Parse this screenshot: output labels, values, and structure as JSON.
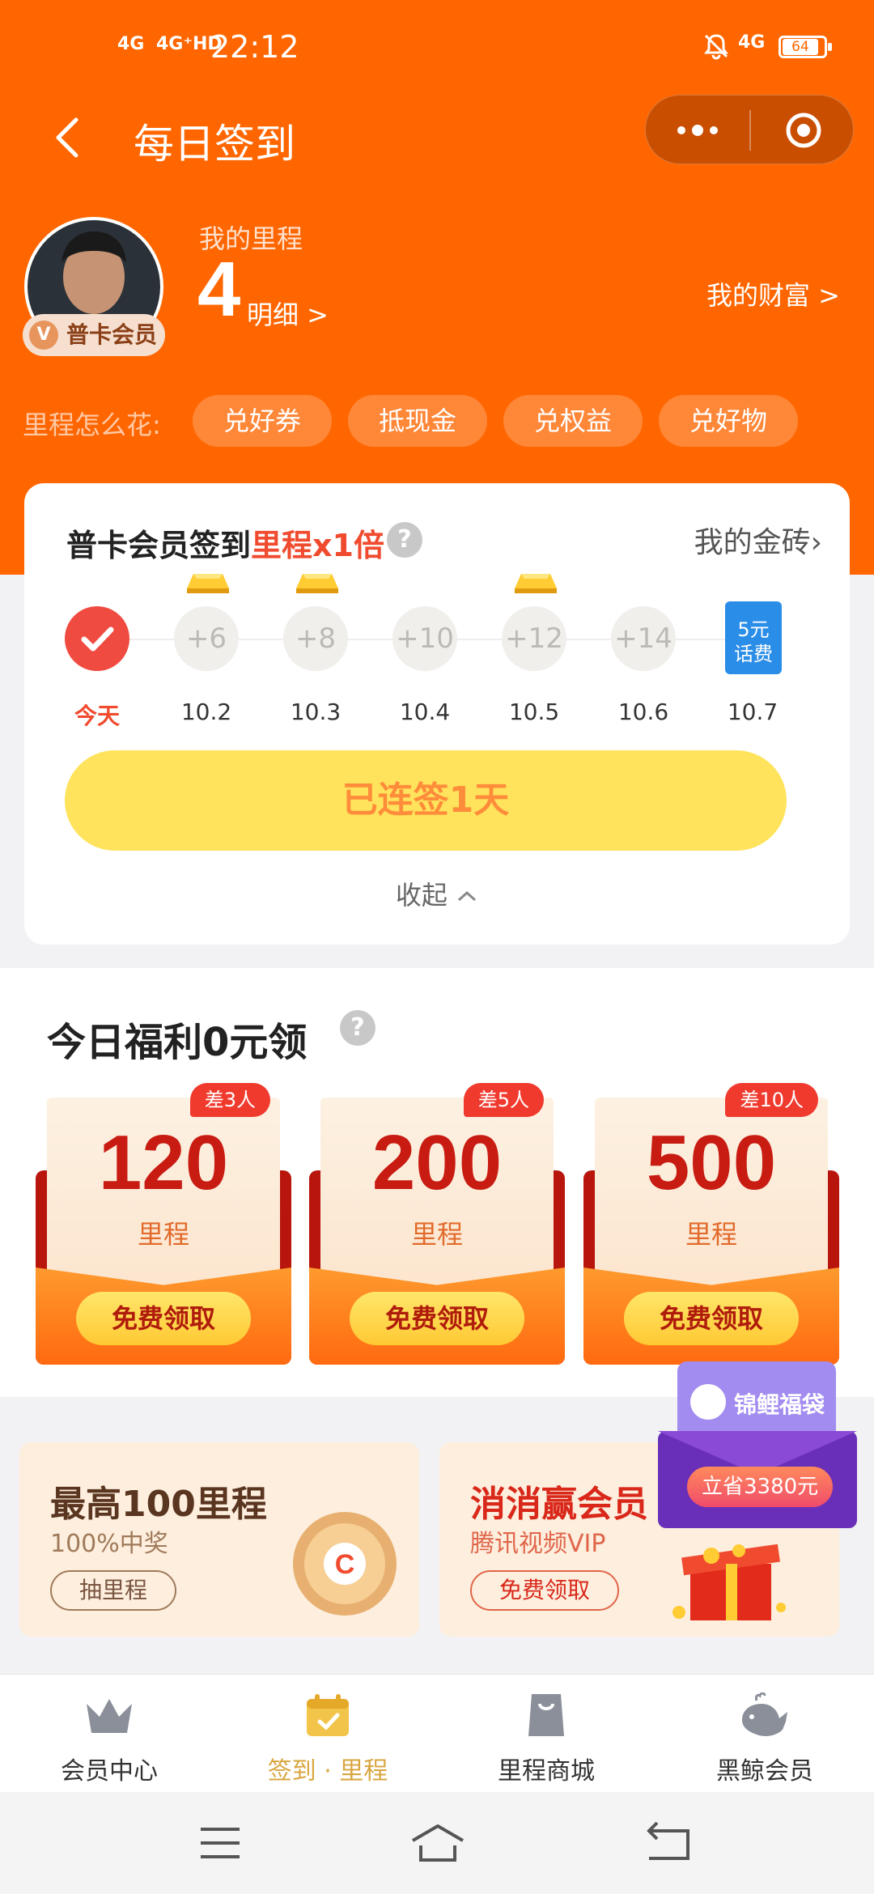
{
  "status_bar": {
    "network_left": "4G",
    "network_left2": "4G⁺HD",
    "time": "22:12",
    "network_right": "4G",
    "battery": "64"
  },
  "nav": {
    "title": "每日签到"
  },
  "profile": {
    "member_level": "普卡会员",
    "member_v": "V",
    "mileage_label": "我的里程",
    "mileage_value": "4",
    "detail_link": "明细 >",
    "wealth_link": "我的财富 >",
    "spend_label": "里程怎么花:",
    "spend_options": [
      "兑好券",
      "抵现金",
      "兑权益",
      "兑好物"
    ]
  },
  "signin": {
    "title_prefix": "普卡会员签到",
    "title_highlight": "里程x1倍",
    "help": "?",
    "bricks_link": "我的金砖›",
    "days": [
      {
        "date": "今天",
        "reward": "",
        "today": true,
        "gold": false
      },
      {
        "date": "10.2",
        "reward": "+6",
        "gold": true
      },
      {
        "date": "10.3",
        "reward": "+8",
        "gold": true
      },
      {
        "date": "10.4",
        "reward": "+10",
        "gold": false
      },
      {
        "date": "10.5",
        "reward": "+12",
        "gold": true
      },
      {
        "date": "10.6",
        "reward": "+14",
        "gold": false
      },
      {
        "date": "10.7",
        "reward": "5元\n话费",
        "ticket": true
      }
    ],
    "streak_button": "已连签1天",
    "collapse": "收起"
  },
  "welfare": {
    "title": "今日福利0元领",
    "help": "?",
    "coupons": [
      {
        "amount": "120",
        "unit": "里程",
        "tag": "差3人",
        "button": "免费领取"
      },
      {
        "amount": "200",
        "unit": "里程",
        "tag": "差5人",
        "button": "免费领取"
      },
      {
        "amount": "500",
        "unit": "里程",
        "tag": "差10人",
        "button": "免费领取"
      }
    ]
  },
  "promos": [
    {
      "title": "最高100里程",
      "sub": "100%中奖",
      "button": "抽里程"
    },
    {
      "title": "消消赢会员",
      "sub": "腾讯视频VIP",
      "button": "免费领取"
    }
  ],
  "lucky_bag": {
    "title": "锦鲤福袋",
    "button": "立省3380元"
  },
  "tabs": [
    {
      "label": "会员中心",
      "active": false
    },
    {
      "label": "签到 · 里程",
      "active": true
    },
    {
      "label": "里程商城",
      "active": false
    },
    {
      "label": "黑鲸会员",
      "active": false
    }
  ],
  "colors": {
    "brand_orange": "#ff6600",
    "highlight_red": "#f04b2f",
    "streak_yellow": "#ffe35c",
    "tab_active": "#d9a640"
  }
}
